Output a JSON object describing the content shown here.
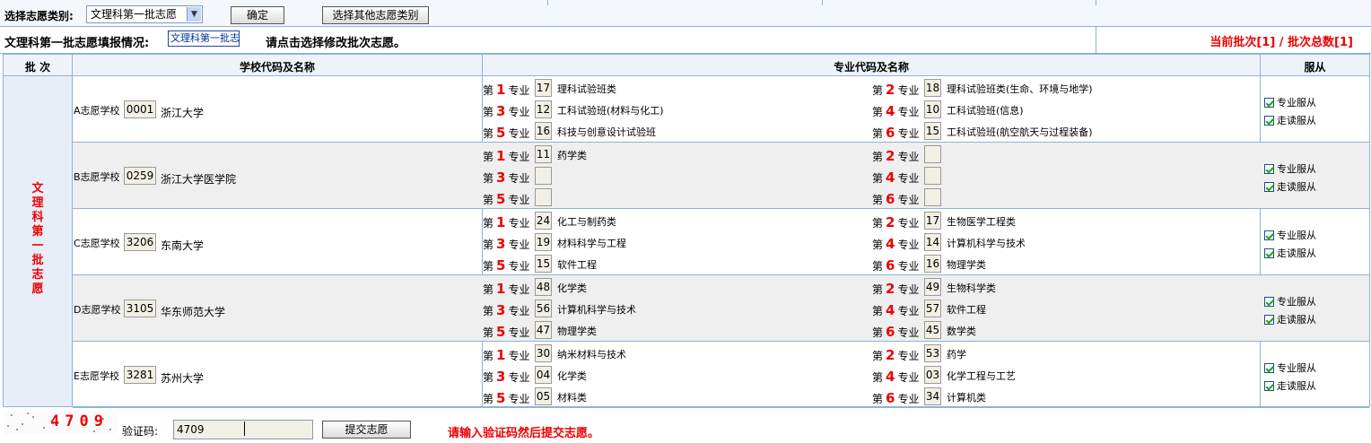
{
  "toolbar": {
    "category_label": "选择志愿类别:",
    "category_value": "文理科第一批志愿",
    "confirm_label": "确定",
    "other_label": "选择其他志愿类别"
  },
  "status": {
    "title": "文理科第一批志愿填报情况:",
    "batch_tag": "文理科第一批志",
    "hint": "请点击选择修改批次志愿。",
    "batch_info": "当前批次[1] / 批次总数[1]"
  },
  "headers": {
    "batch": "批 次",
    "school": "学校代码及名称",
    "major": "专业代码及名称",
    "obey": "服从"
  },
  "batch_name": "文理科第一批志愿",
  "major_prefix": "第",
  "major_suffix": "专业",
  "obey_major": "专业服从",
  "obey_study": "走读服从",
  "schools": [
    {
      "label": "A志愿学校",
      "code": "0001",
      "name": "浙江大学",
      "majors": [
        {
          "n": "1",
          "code": "17",
          "name": "理科试验班类"
        },
        {
          "n": "2",
          "code": "18",
          "name": "理科试验班类(生命、环境与地学)"
        },
        {
          "n": "3",
          "code": "12",
          "name": "工科试验班(材料与化工)"
        },
        {
          "n": "4",
          "code": "10",
          "name": "工科试验班(信息)"
        },
        {
          "n": "5",
          "code": "16",
          "name": "科技与创意设计试验班"
        },
        {
          "n": "6",
          "code": "15",
          "name": "工科试验班(航空航天与过程装备)"
        }
      ]
    },
    {
      "label": "B志愿学校",
      "code": "0259",
      "name": "浙江大学医学院",
      "majors": [
        {
          "n": "1",
          "code": "11",
          "name": "药学类"
        },
        {
          "n": "2",
          "code": "",
          "name": ""
        },
        {
          "n": "3",
          "code": "",
          "name": ""
        },
        {
          "n": "4",
          "code": "",
          "name": ""
        },
        {
          "n": "5",
          "code": "",
          "name": ""
        },
        {
          "n": "6",
          "code": "",
          "name": ""
        }
      ]
    },
    {
      "label": "C志愿学校",
      "code": "3206",
      "name": "东南大学",
      "majors": [
        {
          "n": "1",
          "code": "24",
          "name": "化工与制药类"
        },
        {
          "n": "2",
          "code": "17",
          "name": "生物医学工程类"
        },
        {
          "n": "3",
          "code": "19",
          "name": "材料科学与工程"
        },
        {
          "n": "4",
          "code": "14",
          "name": "计算机科学与技术"
        },
        {
          "n": "5",
          "code": "15",
          "name": "软件工程"
        },
        {
          "n": "6",
          "code": "16",
          "name": "物理学类"
        }
      ]
    },
    {
      "label": "D志愿学校",
      "code": "3105",
      "name": "华东师范大学",
      "majors": [
        {
          "n": "1",
          "code": "48",
          "name": "化学类"
        },
        {
          "n": "2",
          "code": "49",
          "name": "生物科学类"
        },
        {
          "n": "3",
          "code": "56",
          "name": "计算机科学与技术"
        },
        {
          "n": "4",
          "code": "57",
          "name": "软件工程"
        },
        {
          "n": "5",
          "code": "47",
          "name": "物理学类"
        },
        {
          "n": "6",
          "code": "45",
          "name": "数学类"
        }
      ]
    },
    {
      "label": "E志愿学校",
      "code": "3281",
      "name": "苏州大学",
      "majors": [
        {
          "n": "1",
          "code": "30",
          "name": "纳米材料与技术"
        },
        {
          "n": "2",
          "code": "53",
          "name": "药学"
        },
        {
          "n": "3",
          "code": "04",
          "name": "化学类"
        },
        {
          "n": "4",
          "code": "03",
          "name": "化学工程与工艺"
        },
        {
          "n": "5",
          "code": "05",
          "name": "材料类"
        },
        {
          "n": "6",
          "code": "34",
          "name": "计算机类"
        }
      ]
    }
  ],
  "footer": {
    "captcha_image_text": "4709",
    "verify_label": "验证码:",
    "verify_value": "4709",
    "submit_label": "提交志愿",
    "message": "请输入验证码然后提交志愿。"
  }
}
